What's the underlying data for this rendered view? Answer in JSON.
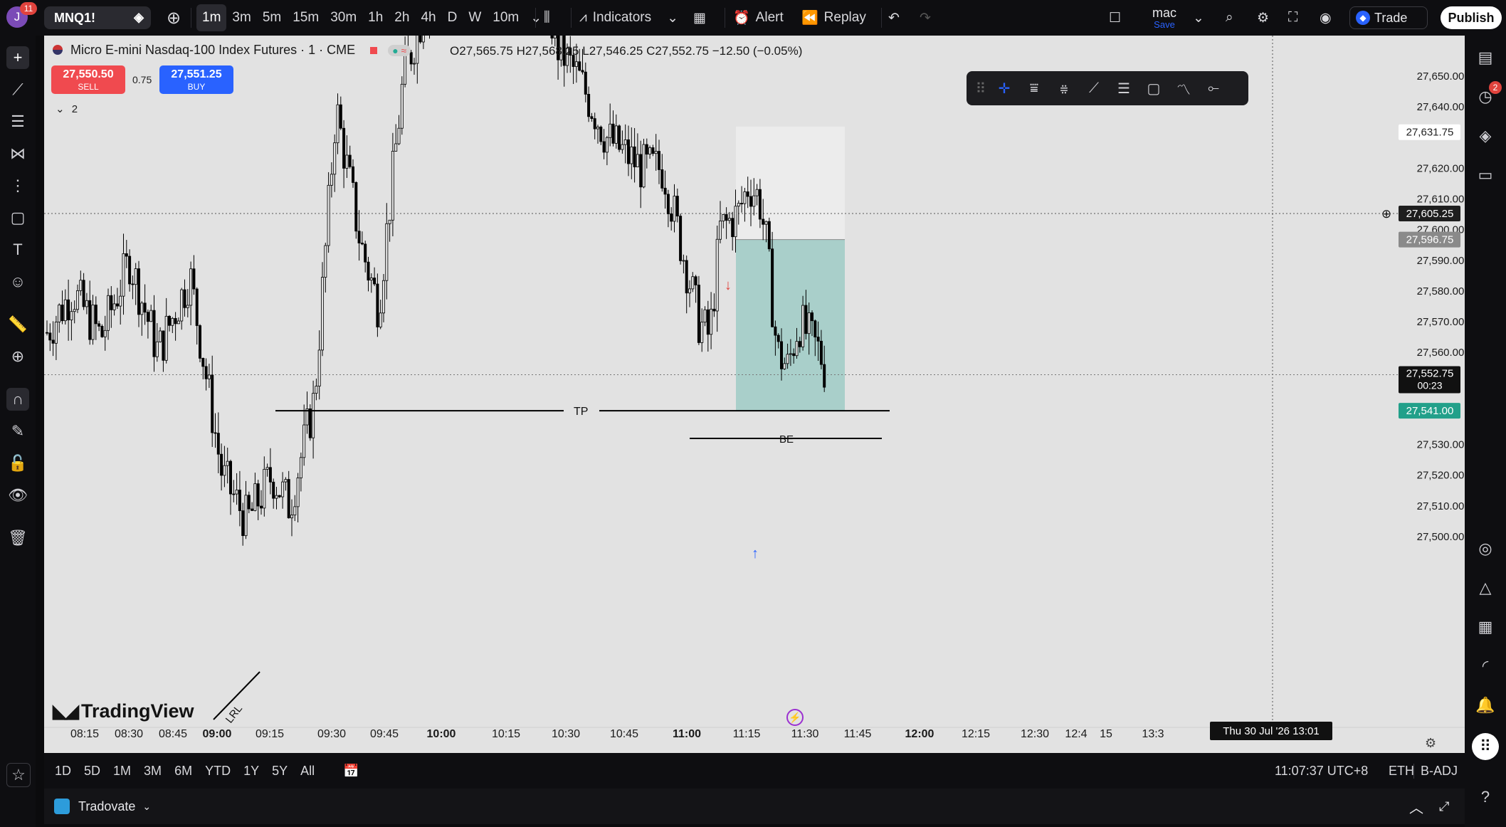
{
  "header": {
    "notification_count": "11",
    "user_initial": "J",
    "symbol": "MNQ1!",
    "intervals": [
      "1m",
      "3m",
      "5m",
      "15m",
      "30m",
      "1h",
      "2h",
      "4h",
      "D",
      "W",
      "10m"
    ],
    "active_interval": "1m",
    "indicators_label": "Indicators",
    "alert_label": "Alert",
    "replay_label": "Replay",
    "layout_name": "mac",
    "layout_save": "Save",
    "trade_label": "Trade",
    "publish_label": "Publish"
  },
  "chart": {
    "instrument_title": "Micro E-mini Nasdaq-100 Index Futures · 1 · CME",
    "ohlc": {
      "O": "27,565.75",
      "H": "27,568.25",
      "L": "27,546.25",
      "C": "27,552.75",
      "change": "−12.50 (−0.05%)"
    },
    "sell": {
      "price": "27,550.50",
      "label": "SELL"
    },
    "buy": {
      "price": "27,551.25",
      "label": "BUY"
    },
    "spread": "0.75",
    "indicator_count": "2",
    "watermark": "TradingView",
    "tp_label": "TP",
    "be_label": "BE",
    "lrl_label": "LRL",
    "crosshair_time": "Thu 30 Jul '26   13:01",
    "price_axis": {
      "ticks": [
        "27,650.00",
        "27,640.00",
        "27,620.00",
        "27,610.00",
        "27,600.00",
        "27,590.00",
        "27,580.00",
        "27,570.00",
        "27,560.00",
        "27,530.00",
        "27,520.00",
        "27,510.00",
        "27,500.00"
      ],
      "labels": {
        "stop": "27,631.75",
        "crosshair": "27,605.25",
        "entry": "27,596.75",
        "last": "27,552.75",
        "countdown": "00:23",
        "target": "27,541.00"
      }
    },
    "time_axis": {
      "ticks": [
        "08:15",
        "08:30",
        "08:45",
        "09:00",
        "09:15",
        "09:30",
        "09:45",
        "10:00",
        "10:15",
        "10:30",
        "10:45",
        "11:00",
        "11:15",
        "11:30",
        "11:45",
        "12:00",
        "12:15",
        "12:30",
        "12:4",
        "15",
        "13:3"
      ],
      "bold": [
        "09:00",
        "10:00",
        "11:00",
        "12:00"
      ]
    }
  },
  "footer": {
    "ranges": [
      "1D",
      "5D",
      "1M",
      "3M",
      "6M",
      "YTD",
      "1Y",
      "5Y",
      "All"
    ],
    "clock": "11:07:37 UTC+8",
    "session": "ETH",
    "adjust": "B-ADJ",
    "broker": "Tradovate"
  },
  "right_sidebar": {
    "alert_badge": "2"
  }
}
